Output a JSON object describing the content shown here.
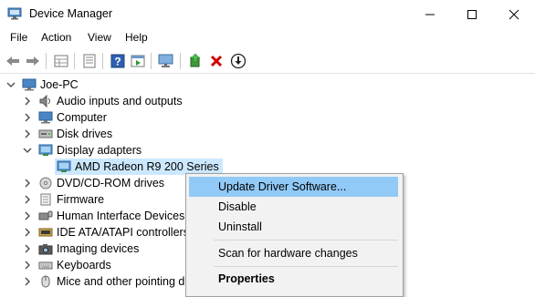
{
  "window": {
    "title": "Device Manager"
  },
  "menu": [
    "File",
    "Action",
    "View",
    "Help"
  ],
  "toolbar": {
    "icons": [
      "back-arrow-icon",
      "forward-arrow-icon",
      "properties-grid-icon",
      "details-list-icon",
      "help-icon",
      "run-icon",
      "scan-monitor-icon",
      "update-driver-icon",
      "uninstall-x-icon",
      "download-driver-icon"
    ]
  },
  "tree": {
    "root": "Joe-PC",
    "items": [
      {
        "label": "Audio inputs and outputs",
        "icon": "speaker-icon"
      },
      {
        "label": "Computer",
        "icon": "computer-icon"
      },
      {
        "label": "Disk drives",
        "icon": "disk-drive-icon"
      },
      {
        "label": "Display adapters",
        "icon": "display-adapter-icon",
        "expanded": true
      },
      {
        "label": "AMD Radeon R9 200 Series",
        "icon": "display-adapter-icon",
        "child": true,
        "selected": true
      },
      {
        "label": "DVD/CD-ROM drives",
        "icon": "dvd-icon"
      },
      {
        "label": "Firmware",
        "icon": "firmware-icon"
      },
      {
        "label": "Human Interface Devices",
        "icon": "hid-icon"
      },
      {
        "label": "IDE ATA/ATAPI controllers",
        "icon": "ide-controller-icon"
      },
      {
        "label": "Imaging devices",
        "icon": "camera-icon"
      },
      {
        "label": "Keyboards",
        "icon": "keyboard-icon"
      },
      {
        "label": "Mice and other pointing d",
        "icon": "mouse-icon"
      }
    ]
  },
  "context_menu": {
    "items": [
      {
        "label": "Update Driver Software...",
        "highlighted": true
      },
      {
        "label": "Disable"
      },
      {
        "label": "Uninstall"
      },
      {
        "label": "Scan for hardware changes"
      },
      {
        "label": "Properties",
        "bold": true
      }
    ]
  },
  "colors": {
    "selection": "#cce8ff",
    "menu_highlight": "#91c9f7",
    "uninstall_red": "#d10000"
  }
}
